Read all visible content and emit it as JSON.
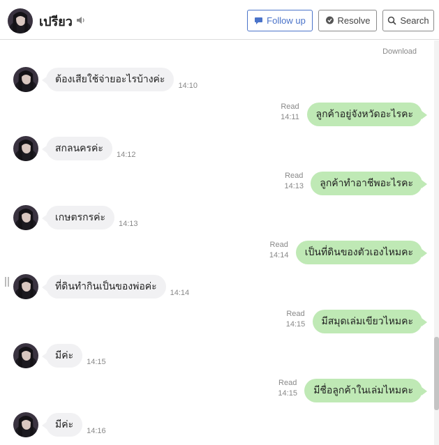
{
  "header": {
    "contact_name": "เปรียว",
    "follow_up_label": "Follow up",
    "resolve_label": "Resolve",
    "search_label": "Search"
  },
  "chat": {
    "download_label": "Download",
    "messages": [
      {
        "direction": "in",
        "text": "ต้องเสียใช้จ่ายอะไรบ้างค่ะ",
        "time": "14:10"
      },
      {
        "direction": "out",
        "text": "ลูกค้าอยู่จังหวัดอะไรคะ",
        "status": "Read",
        "time": "14:11"
      },
      {
        "direction": "in",
        "text": "สกลนครค่ะ",
        "time": "14:12"
      },
      {
        "direction": "out",
        "text": "ลูกค้าทำอาชีพอะไรคะ",
        "status": "Read",
        "time": "14:13"
      },
      {
        "direction": "in",
        "text": "เกษตรกรค่ะ",
        "time": "14:13"
      },
      {
        "direction": "out",
        "text": "เป็นที่ดินของตัวเองไหมคะ",
        "status": "Read",
        "time": "14:14"
      },
      {
        "direction": "in",
        "text": "ที่ดินทำกินเป็นของพ่อค่ะ",
        "time": "14:14"
      },
      {
        "direction": "out",
        "text": "มีสมุดเล่มเขียวไหมคะ",
        "status": "Read",
        "time": "14:15"
      },
      {
        "direction": "in",
        "text": "มีค่ะ",
        "time": "14:15"
      },
      {
        "direction": "out",
        "text": "มีชื่อลูกค้าในเล่มไหมคะ",
        "status": "Read",
        "time": "14:15"
      },
      {
        "direction": "in",
        "text": "มีค่ะ",
        "time": "14:16"
      }
    ]
  },
  "colors": {
    "accent": "#4a73c9",
    "outgoing_bubble": "#bfe9b5",
    "incoming_bubble": "#f1f1f3"
  }
}
